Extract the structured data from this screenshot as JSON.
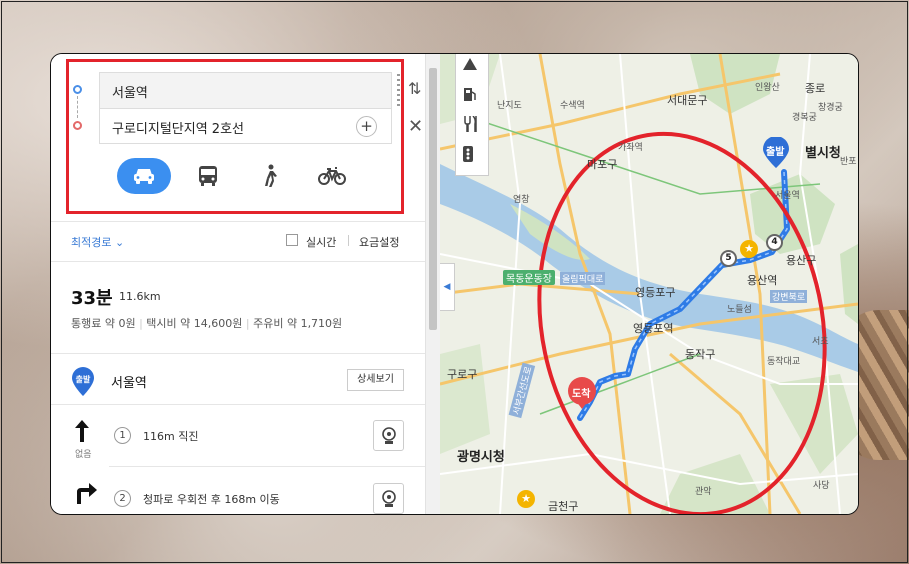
{
  "route_panel": {
    "start": "서울역",
    "destination": "구로디지털단지역 2호선",
    "add_label": "+",
    "swap_icon": "swap-vertical-icon",
    "close_icon": "close-icon",
    "modes": [
      {
        "name": "car",
        "icon": "car-icon",
        "selected": true
      },
      {
        "name": "bus",
        "icon": "bus-icon",
        "selected": false
      },
      {
        "name": "walk",
        "icon": "walk-icon",
        "selected": false
      },
      {
        "name": "bike",
        "icon": "bicycle-icon",
        "selected": false
      }
    ],
    "highlight_color": "#e3232b"
  },
  "options": {
    "route_type": "최적경로",
    "realtime": "실시간",
    "fare_settings": "요금설정"
  },
  "summary": {
    "time": "33분",
    "distance": "11.6km",
    "toll": "통행료 약 0원",
    "taxi": "택시비 약 14,600원",
    "fuel": "주유비 약 1,710원"
  },
  "start_point": {
    "badge": "출발",
    "name": "서울역",
    "detail_button": "상세보기"
  },
  "steps": [
    {
      "num": "1",
      "text": "116m 직진",
      "sub": "없음"
    },
    {
      "num": "2",
      "text": "청파로 우회전 후 168m 이동"
    }
  ],
  "map": {
    "start_badge": "출발",
    "end_badge": "도착",
    "route_color": "#2e7be6",
    "circle_color": "#e3232b",
    "waypoints": [
      "5",
      "4"
    ],
    "labels": {
      "seodaemun": "서대문구",
      "inwangsan": "인왕산",
      "jongno": "종로",
      "changgyeong": "창경궁",
      "gyeongbokgung": "경복궁",
      "byeolsi": "별시청",
      "nanji": "난지도",
      "susaek": "수색역",
      "gajwa": "가좌역",
      "mapo": "마포구",
      "seoulyeok": "서울역",
      "yongsan": "용산구",
      "yongsanyeok": "용산역",
      "yeongdeungpo": "영등포구",
      "yeongdeungpoyeok": "영등포역",
      "mokdong": "목동운동장",
      "dongjak": "동작구",
      "nodeul": "노들섬",
      "dongjakbridge": "동작대교",
      "seochi": "서초",
      "guro": "구로구",
      "gwangmyeong": "광명시청",
      "geumcheon": "금천구",
      "gwanak": "관악",
      "sadang": "사당",
      "gangbyeon_bukro": "강변북로",
      "olympic": "올림픽대로",
      "seobu": "서부간선도로",
      "yeomchang": "염창",
      "banpo": "반포"
    }
  }
}
